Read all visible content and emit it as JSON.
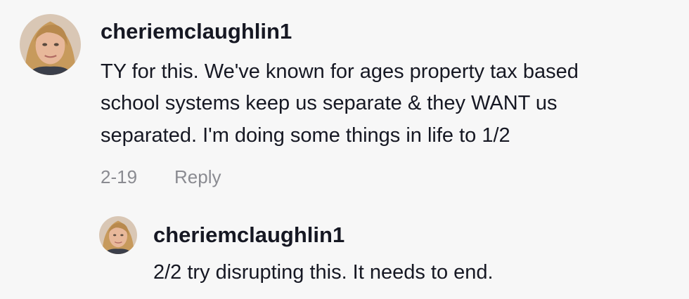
{
  "comments": [
    {
      "username": "cheriemclaughlin1",
      "text_lines": [
        "TY for this. We've known for ages property tax based",
        "school systems keep us separate & they WANT us",
        "separated. I'm doing some things in life to 1/2"
      ],
      "date": "2-19",
      "reply_label": "Reply"
    },
    {
      "username": "cheriemclaughlin1",
      "text": "2/2 try disrupting this. It needs to end."
    }
  ]
}
